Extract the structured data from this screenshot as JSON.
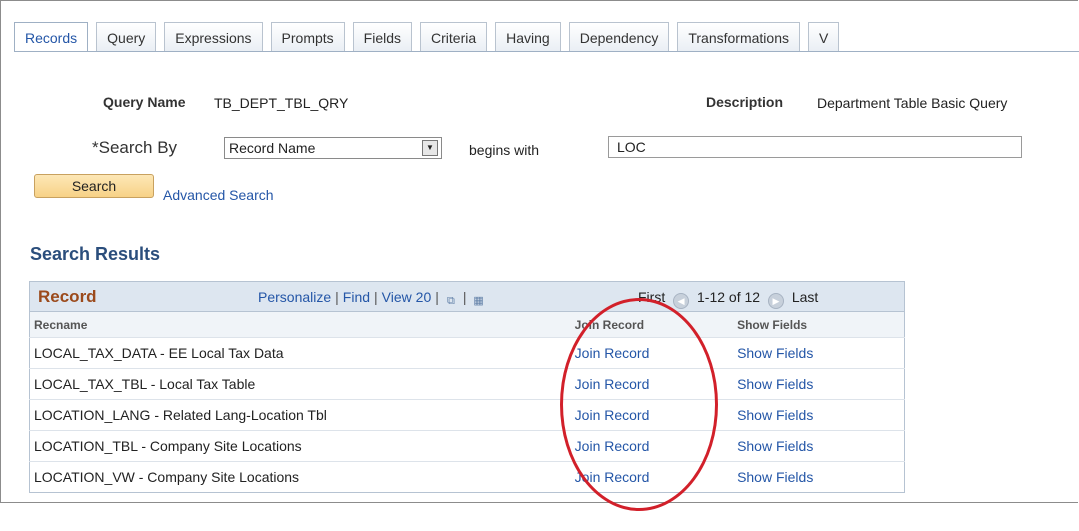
{
  "tabs": [
    "Records",
    "Query",
    "Expressions",
    "Prompts",
    "Fields",
    "Criteria",
    "Having",
    "Dependency",
    "Transformations",
    "V"
  ],
  "query": {
    "name_label": "Query Name",
    "name_value": "TB_DEPT_TBL_QRY",
    "description_label": "Description",
    "description_value": "Department Table Basic Query"
  },
  "search": {
    "search_by_label": "*Search By",
    "search_by_value": "Record Name",
    "operator": "begins with",
    "term": "LOC",
    "search_button": "Search",
    "advanced_link": "Advanced Search"
  },
  "results": {
    "title": "Search Results",
    "grid_title": "Record",
    "nav": {
      "personalize": "Personalize",
      "find": "Find",
      "view": "View 20"
    },
    "pager": {
      "first": "First",
      "range": "1-12 of 12",
      "last": "Last"
    },
    "columns": [
      "Recname",
      "Join Record",
      "Show Fields"
    ],
    "rows": [
      {
        "recname": "LOCAL_TAX_DATA - EE Local Tax Data",
        "join": "Join Record",
        "show": "Show Fields"
      },
      {
        "recname": "LOCAL_TAX_TBL - Local Tax Table",
        "join": "Join Record",
        "show": "Show Fields"
      },
      {
        "recname": "LOCATION_LANG - Related Lang-Location Tbl",
        "join": "Join Record",
        "show": "Show Fields"
      },
      {
        "recname": "LOCATION_TBL - Company Site Locations",
        "join": "Join Record",
        "show": "Show Fields"
      },
      {
        "recname": "LOCATION_VW - Company Site Locations",
        "join": "Join Record",
        "show": "Show Fields"
      }
    ]
  },
  "colors": {
    "accent_link": "#2456a7",
    "annotation": "#d2202a",
    "grid_title": "#9b4a1c"
  }
}
